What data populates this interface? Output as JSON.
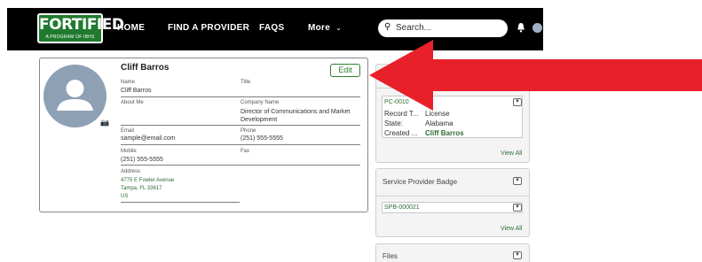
{
  "nav": {
    "logo_text": "FORTIFIED",
    "logo_sub": "A PROGRAM OF IBHS",
    "items": [
      {
        "label": "HOME"
      },
      {
        "label": "FIND A PROVIDER"
      },
      {
        "label": "FAQS"
      },
      {
        "label": "More"
      }
    ],
    "search_placeholder": "Search..."
  },
  "profile": {
    "name": "Cliff Barros",
    "edit_label": "Edit",
    "fields": {
      "name_label": "Name",
      "name_value": "Cliff Barros",
      "title_label": "Title",
      "about_label": "About Me",
      "company_label": "Company Name",
      "company_value_1": "Director of Communications and Market",
      "company_value_2": "Development",
      "email_label": "Email",
      "email_value": "sample@email.com",
      "phone_label": "Phone",
      "phone_value": "(251) 555-5555",
      "mobile_label": "Mobile",
      "mobile_value": "(251) 555-5555",
      "fax_label": "Fax",
      "address_label": "Address",
      "address_line1": "4775 E Fowler Avenue",
      "address_line2": "Tampa, FL 33617",
      "address_line3": "US"
    }
  },
  "license_panel": {
    "record_id": "PC-0010",
    "rows": [
      {
        "k": "Record T...",
        "v": "License"
      },
      {
        "k": "State:",
        "v": "Alabama"
      },
      {
        "k": "Created ...",
        "v": "Cliff Barros"
      }
    ],
    "view_all": "View All"
  },
  "badge_panel": {
    "title": "Service Provider Badge",
    "record_id": "SPB-000021",
    "view_all": "View All"
  },
  "files_panel": {
    "title": "Files"
  },
  "colors": {
    "brand_green": "#1f7a2e",
    "link_green": "#2e6d35",
    "arrow_red": "#e8202a"
  }
}
